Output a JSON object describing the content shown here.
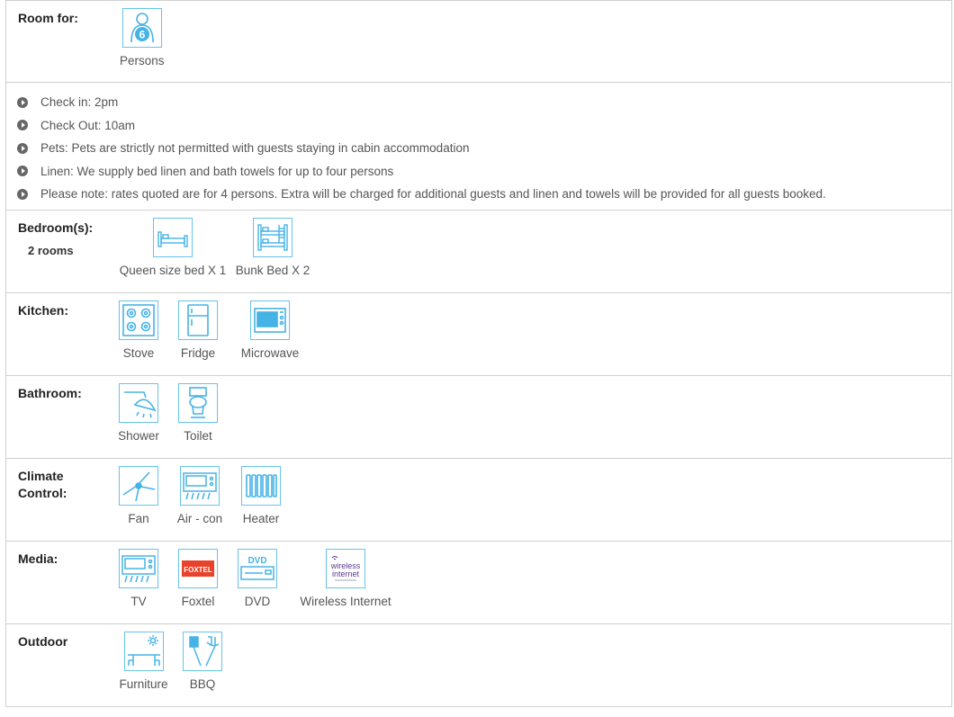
{
  "room_for": {
    "label": "Room for:",
    "persons_count": "6",
    "persons_label": "Persons"
  },
  "notes": [
    "Check in: 2pm",
    "Check Out: 10am",
    "Pets: Pets are strictly not permitted with guests staying in cabin accommodation",
    "Linen: We supply bed linen and bath towels for up to four persons",
    "Please note: rates quoted are for 4 persons. Extra will be charged for additional guests and linen and towels will be provided for all guests booked."
  ],
  "bedrooms": {
    "label": "Bedroom(s):",
    "rooms": "2 rooms",
    "items": [
      {
        "label": "Queen size bed X 1",
        "icon": "queen-bed-icon"
      },
      {
        "label": "Bunk Bed X 2",
        "icon": "bunk-bed-icon"
      }
    ]
  },
  "kitchen": {
    "label": "Kitchen:",
    "items": [
      {
        "label": "Stove",
        "icon": "stove-icon"
      },
      {
        "label": "Fridge",
        "icon": "fridge-icon"
      },
      {
        "label": "Microwave",
        "icon": "microwave-icon"
      }
    ]
  },
  "bathroom": {
    "label": "Bathroom:",
    "items": [
      {
        "label": "Shower",
        "icon": "shower-icon"
      },
      {
        "label": "Toilet",
        "icon": "toilet-icon"
      }
    ]
  },
  "climate": {
    "label_line1": "Climate",
    "label_line2": "Control:",
    "items": [
      {
        "label": "Fan",
        "icon": "ceiling-fan-icon"
      },
      {
        "label": "Air - con",
        "icon": "air-con-icon"
      },
      {
        "label": "Heater",
        "icon": "heater-icon"
      }
    ]
  },
  "media": {
    "label": "Media:",
    "items": [
      {
        "label": "TV",
        "icon": "tv-icon"
      },
      {
        "label": "Foxtel",
        "icon": "foxtel-logo-icon",
        "logo_text": "FOXTEL"
      },
      {
        "label": "DVD",
        "icon": "dvd-icon",
        "logo_text": "DVD"
      },
      {
        "label": "Wireless Internet",
        "icon": "wireless-internet-logo-icon",
        "logo_text_1": "wireless",
        "logo_text_2": "internet"
      }
    ]
  },
  "outdoor": {
    "label": "Outdoor",
    "items": [
      {
        "label": "Furniture",
        "icon": "outdoor-furniture-icon"
      },
      {
        "label": "BBQ",
        "icon": "bbq-icon"
      }
    ]
  },
  "colors": {
    "accent": "#46b3e6",
    "border": "#d0d0d0",
    "foxtel": "#e8422a",
    "wireless": "#5a3b8c"
  }
}
